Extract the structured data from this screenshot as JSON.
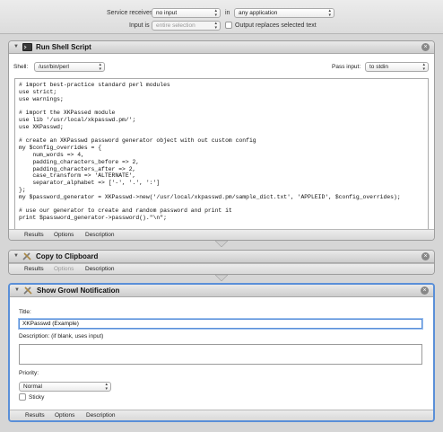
{
  "service_bar": {
    "receives_label": "Service receives",
    "receives_value": "no input",
    "in_label": "in",
    "app_value": "any application",
    "input_is_label": "Input is",
    "input_is_value": "entire selection",
    "replace_label": "Output replaces selected text"
  },
  "actions": {
    "shell": {
      "title": "Run Shell Script",
      "shell_label": "Shell:",
      "shell_value": "/usr/bin/perl",
      "pass_input_label": "Pass input:",
      "pass_input_value": "to stdin",
      "script": "# import best-practice standard perl modules\nuse strict;\nuse warnings;\n\n# import the XKPassed module\nuse lib '/usr/local/xkpasswd.pm/';\nuse XKPasswd;\n\n# create an XKPasswd password generator object with out custom config\nmy $config_overrides = {\n    num_words => 4,\n    padding_characters_before => 2,\n    padding_characters_after => 2,\n    case_transform => 'ALTERNATE',\n    separator_alphabet => ['-', '.', ':']\n};\nmy $password_generator = XKPasswd->new('/usr/local/xkpasswd.pm/sample_dict.txt', 'APPLEID', $config_overrides);\n\n# use our generator to create and random password and print it\nprint $password_generator->password().\"\\n\";",
      "tabs": [
        "Results",
        "Options",
        "Description"
      ]
    },
    "clipboard": {
      "title": "Copy to Clipboard",
      "tabs": [
        "Results",
        "Options",
        "Description"
      ]
    },
    "growl": {
      "title": "Show Growl Notification",
      "title_label": "Title:",
      "title_value": "XKPasswd (Example)",
      "description_label": "Description: (if blank, uses input)",
      "description_value": "",
      "priority_label": "Priority:",
      "priority_value": "Normal",
      "sticky_label": "Sticky",
      "tabs": [
        "Results",
        "Options",
        "Description"
      ]
    }
  },
  "colors": {
    "selection_border": "#5a8fd8",
    "background": "#d6d6d6"
  },
  "icons": [
    "terminal-icon",
    "tools-icon",
    "close-icon",
    "disclosure-triangle-icon"
  ]
}
